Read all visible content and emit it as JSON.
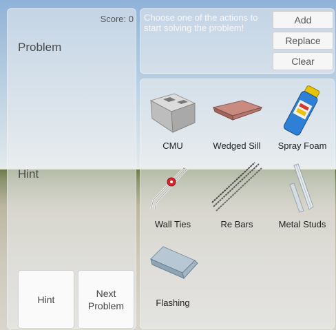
{
  "score_text": "Score: 0",
  "left_panel": {
    "problem_label": "Problem",
    "hint_label": "Hint"
  },
  "buttons": {
    "hint": "Hint",
    "next_problem": "Next\nProblem"
  },
  "message": "Choose one of the actions to start solving the problem!",
  "actions": {
    "add": "Add",
    "replace": "Replace",
    "clear": "Clear"
  },
  "materials": [
    {
      "label": "CMU",
      "icon": "cmu-block-icon"
    },
    {
      "label": "Wedged Sill",
      "icon": "wedged-sill-icon"
    },
    {
      "label": "Spray Foam",
      "icon": "spray-foam-can-icon"
    },
    {
      "label": "Wall Ties",
      "icon": "wall-tie-icon"
    },
    {
      "label": "Re Bars",
      "icon": "rebar-icon"
    },
    {
      "label": "Metal Studs",
      "icon": "metal-stud-icon"
    },
    {
      "label": "Flashing",
      "icon": "flashing-icon"
    }
  ]
}
